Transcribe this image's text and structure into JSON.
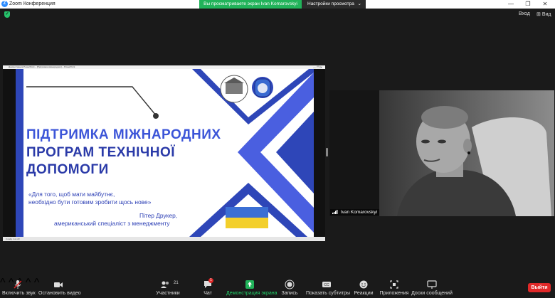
{
  "window": {
    "title": "Zoom Конференция"
  },
  "share_banner": {
    "text": "Вы просматриваете экран Ivan Komarovskyi",
    "view_options": "Настройки просмотра"
  },
  "top_right": {
    "sign_in": "Вход",
    "view": "Вид"
  },
  "ppt": {
    "titlebar": "Демонстрация PowerPoint – [Підтримка міжнародних] – PowerPoint",
    "status": "Слайд 1 из 23",
    "slide": {
      "title_line1": "ПІДТРИМКА МІЖНАРОДНИХ",
      "title_line2": "ПРОГРАМ ТЕХНІЧНОЇ",
      "title_line3": "ДОПОМОГИ",
      "quote_line1": "«Для того, щоб мати майбутнє,",
      "quote_line2": "необхідно бути готовим зробити щось нове»",
      "author_line1": "Пітер Друкер,",
      "author_line2": "американський спеціаліст з менеджменту"
    }
  },
  "video": {
    "participant_name": "Ivan Komarovskyi"
  },
  "toolbar": {
    "mute": "Включить звук",
    "video": "Остановить видео",
    "participants": "Участники",
    "participants_count": "21",
    "chat": "Чат",
    "chat_badge": "1",
    "share": "Демонстрация экрана",
    "record": "Запись",
    "captions": "Показать субтитры",
    "reactions": "Реакции",
    "apps": "Приложения",
    "whiteboards": "Доски сообщений",
    "leave": "Выйти"
  },
  "colors": {
    "accent_green": "#21b35a",
    "slide_blue": "#2e46b8",
    "leave_red": "#e02828"
  }
}
